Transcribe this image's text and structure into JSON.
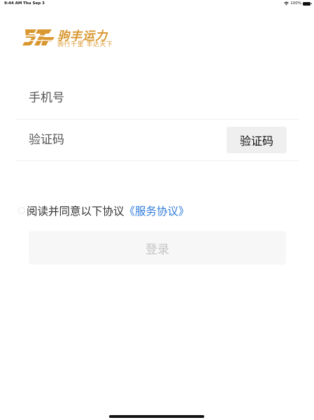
{
  "status_bar": {
    "time": "9:44 AM",
    "date": "Thu Sep 3",
    "battery": "100%"
  },
  "logo": {
    "title": "驹丰运力",
    "slogan": "驹行千里 丰达天下",
    "icon": "logo-mark",
    "color": "#d9972f"
  },
  "form": {
    "phone_placeholder": "手机号",
    "phone_value": "",
    "code_placeholder": "验证码",
    "code_value": "",
    "code_button_label": "验证码"
  },
  "agreement": {
    "text": "阅读并同意以下协议",
    "link_text": "《服务协议》",
    "checked": false,
    "link_color": "#2f7bd9"
  },
  "login_button_label": "登录"
}
